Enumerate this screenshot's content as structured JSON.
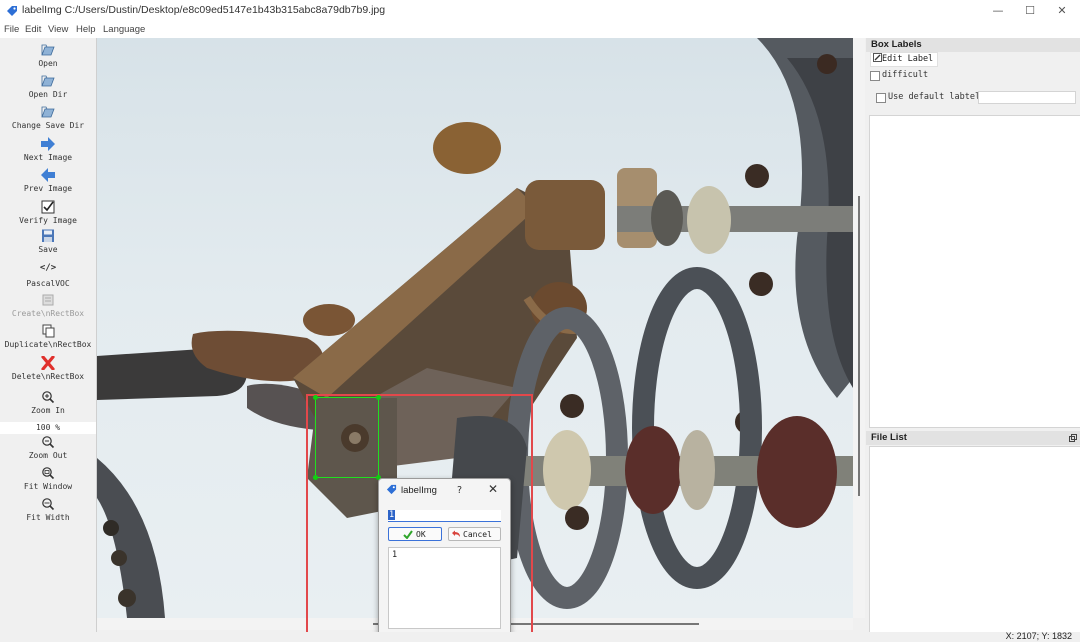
{
  "window": {
    "title": "labelImg C:/Users/Dustin/Desktop/e8c09ed5147e1b43b315abc8a79db7b9.jpg",
    "minimize": "—",
    "maximize": "☐",
    "close": "✕"
  },
  "menu": [
    "File",
    "Edit",
    "View",
    "Help",
    "Language"
  ],
  "toolbar": {
    "open": "Open",
    "open_dir": "Open Dir",
    "change_save_dir": "Change Save Dir",
    "next_image": "Next Image",
    "prev_image": "Prev Image",
    "verify_image": "Verify Image",
    "save": "Save",
    "pascal_voc_icon": "</>",
    "pascal_voc": "PascalVOC",
    "create_rectbox": "Create\\nRectBox",
    "duplicate_rectbox": "Duplicate\\nRectBox",
    "delete_rectbox": "Delete\\nRectBox",
    "zoom_in": "Zoom In",
    "zoom_value": "100 %",
    "zoom_out": "Zoom Out",
    "fit_window": "Fit Window",
    "fit_width": "Fit Width"
  },
  "box_labels": {
    "header": "Box Labels",
    "edit_label": "Edit Label",
    "difficult": "difficult",
    "use_default_label": "Use default labtel"
  },
  "file_list": {
    "header": "File List"
  },
  "dialog": {
    "title": "labelImg",
    "help": "?",
    "close": "✕",
    "input_value": "1",
    "ok": "OK",
    "cancel": "Cancel",
    "list_items": [
      "1"
    ]
  },
  "status": {
    "coords": "X: 2107; Y: 1832"
  },
  "colors": {
    "selection_box": "#20e020",
    "highlight_frame": "#e2484b",
    "accent": "#3b72d9"
  }
}
